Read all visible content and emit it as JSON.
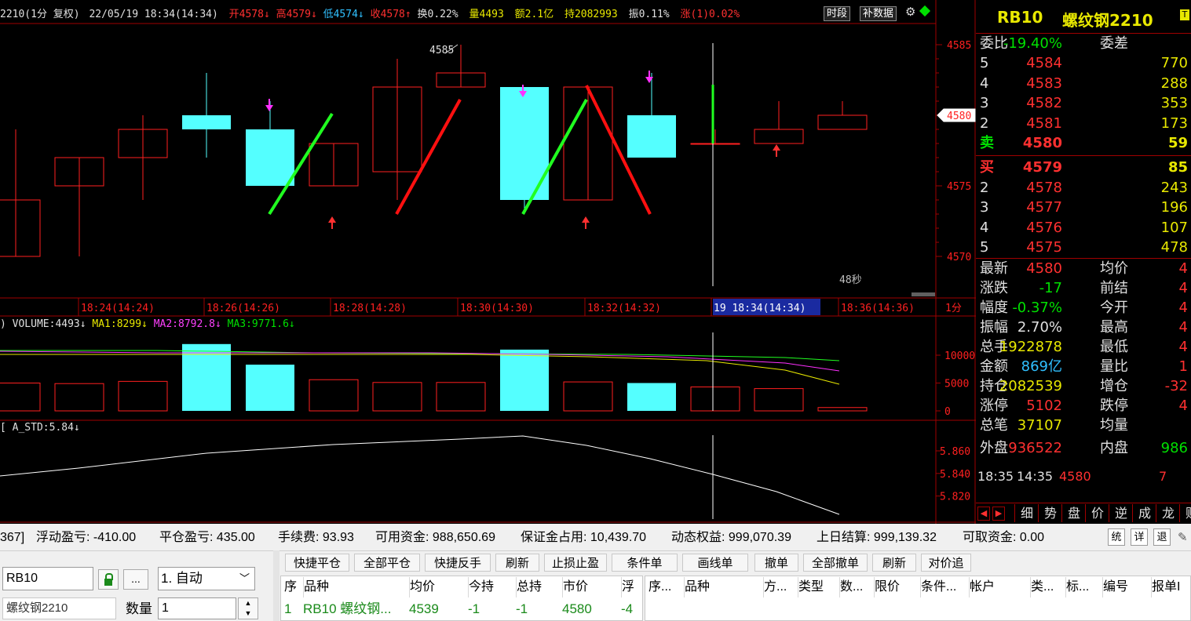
{
  "header": {
    "symbol_period": "2210(1分",
    "adjust": "复权)",
    "datetime": "22/05/19 18:34(14:34)",
    "open": "开4578",
    "high": "高4579",
    "low": "低4574",
    "close": "收4578",
    "turnover": "换0.22%",
    "volume": "量4493",
    "amount": "额2.1亿",
    "position": "持2082993",
    "amplitude": "振0.11%",
    "limit": "涨(1)0.02%",
    "btn_period": "时段",
    "btn_fill": "补数据"
  },
  "price_axis": {
    "ticks": [
      "4585",
      "4580",
      "4575",
      "4570"
    ],
    "current": "4580"
  },
  "main_chart": {
    "peak_label": "4585",
    "countdown": "48秒",
    "candles": [
      {
        "o": 4574.0,
        "c": 4570.0,
        "h": 4579.0,
        "l": 4570.0,
        "color": "red"
      },
      {
        "o": 4575.0,
        "c": 4577.0,
        "h": 4577.0,
        "l": 4570.0,
        "color": "red"
      },
      {
        "o": 4577.0,
        "c": 4579.0,
        "h": 4580.0,
        "l": 4574.0,
        "color": "red"
      },
      {
        "o": 4580.0,
        "c": 4579.0,
        "h": 4583.0,
        "l": 4577.0,
        "color": "cyan"
      },
      {
        "o": 4579.0,
        "c": 4575.0,
        "h": 4581.0,
        "l": 4575.0,
        "color": "cyan"
      },
      {
        "o": 4575.0,
        "c": 4578.0,
        "h": 4578.0,
        "l": 4575.0,
        "color": "red"
      },
      {
        "o": 4576.0,
        "c": 4582.0,
        "h": 4584.0,
        "l": 4574.0,
        "color": "red"
      },
      {
        "o": 4582.0,
        "c": 4583.0,
        "h": 4585.0,
        "l": 4582.0,
        "color": "red"
      },
      {
        "o": 4582.0,
        "c": 4574.0,
        "h": 4582.0,
        "l": 4573.0,
        "color": "cyan"
      },
      {
        "o": 4574.0,
        "c": 4582.0,
        "h": 4582.0,
        "l": 4574.0,
        "color": "red"
      },
      {
        "o": 4580.0,
        "c": 4577.0,
        "h": 4583.0,
        "l": 4577.0,
        "color": "cyan"
      },
      {
        "o": 4578.0,
        "c": 4578.0,
        "h": 4579.0,
        "l": 4578.0,
        "color": "red"
      },
      {
        "o": 4578.0,
        "c": 4579.0,
        "h": 4581.0,
        "l": 4579.0,
        "color": "red"
      },
      {
        "o": 4579.0,
        "c": 4580.0,
        "h": 4581.0,
        "l": 4580.0,
        "color": "red"
      }
    ]
  },
  "time_axis": {
    "labels": [
      "18:24(14:24)",
      "18:26(14:26)",
      "18:28(14:28)",
      "18:30(14:30)",
      "18:32(14:32)",
      "19 18:34(14:34)",
      "18:36(14:36)"
    ],
    "period": "1分"
  },
  "volume_panel": {
    "title": ") VOLUME:4493",
    "ma1": "MA1:8299",
    "ma2": "MA2:8792.8",
    "ma3": "MA3:9771.6",
    "ticks": [
      "10000",
      "5000",
      "0"
    ],
    "bars": [
      {
        "v": 5000,
        "color": "red"
      },
      {
        "v": 4900,
        "color": "red"
      },
      {
        "v": 5300,
        "color": "red"
      },
      {
        "v": 12000,
        "color": "cyan"
      },
      {
        "v": 8300,
        "color": "cyan"
      },
      {
        "v": 5600,
        "color": "red"
      },
      {
        "v": 5100,
        "color": "red"
      },
      {
        "v": 5100,
        "color": "red"
      },
      {
        "v": 11000,
        "color": "cyan"
      },
      {
        "v": 5200,
        "color": "red"
      },
      {
        "v": 5000,
        "color": "cyan"
      },
      {
        "v": 4300,
        "color": "red"
      },
      {
        "v": 4000,
        "color": "red"
      },
      {
        "v": 600,
        "color": "red"
      }
    ]
  },
  "std_panel": {
    "title": "[ A_STD:5.84",
    "ticks": [
      "5.860",
      "5.840",
      "5.820"
    ]
  },
  "quote": {
    "symbol": "RB10",
    "name": "螺纹钢2210",
    "ratio_label": "委比",
    "ratio_value": "-19.40%",
    "diff_label": "委差",
    "asks": [
      {
        "level": "5",
        "price": "4584",
        "vol": "770"
      },
      {
        "level": "4",
        "price": "4583",
        "vol": "288"
      },
      {
        "level": "3",
        "price": "4582",
        "vol": "353"
      },
      {
        "level": "2",
        "price": "4581",
        "vol": "173"
      },
      {
        "level": "卖",
        "price": "4580",
        "vol": "59"
      }
    ],
    "bids": [
      {
        "level": "买",
        "price": "4579",
        "vol": "85"
      },
      {
        "level": "2",
        "price": "4578",
        "vol": "243"
      },
      {
        "level": "3",
        "price": "4577",
        "vol": "196"
      },
      {
        "level": "4",
        "price": "4576",
        "vol": "107"
      },
      {
        "level": "5",
        "price": "4575",
        "vol": "478"
      }
    ],
    "stats": [
      {
        "l1": "最新",
        "v1": "4580",
        "l2": "均价",
        "v2": "4",
        "c": "#ff3030"
      },
      {
        "l1": "涨跌",
        "v1": "-17",
        "l2": "前结",
        "v2": "4",
        "c": "#00e000"
      },
      {
        "l1": "幅度",
        "v1": "-0.37%",
        "l2": "今开",
        "v2": "4",
        "c": "#00e000"
      },
      {
        "l1": "振幅",
        "v1": "2.70%",
        "l2": "最高",
        "v2": "4",
        "c": "#e0e0e0"
      },
      {
        "l1": "总手",
        "v1": "1922878",
        "l2": "最低",
        "v2": "4",
        "c": "#e8e800"
      },
      {
        "l1": "金额",
        "v1": "869亿",
        "l2": "量比",
        "v2": "1",
        "c": "#30c0ff"
      },
      {
        "l1": "持仓",
        "v1": "2082539",
        "l2": "增仓",
        "v2": "-32",
        "c": "#e8e800"
      },
      {
        "l1": "涨停",
        "v1": "5102",
        "l2": "跌停",
        "v2": "4",
        "c": "#ff3030"
      },
      {
        "l1": "总笔",
        "v1": "37107",
        "l2": "均量",
        "v2": "",
        "c": "#e8e800"
      }
    ],
    "outer_label": "外盘",
    "outer_value": "936522",
    "inner_label": "内盘",
    "inner_value": "986",
    "tick_time": "18:35",
    "tick_time2": "14:35",
    "tick_price": "4580",
    "tick_vol": "7",
    "tabs": [
      "细",
      "势",
      "盘",
      "价",
      "逆",
      "成",
      "龙",
      "财"
    ]
  },
  "account": {
    "id_fragment": "367]",
    "float_pl": "浮动盈亏: -410.00",
    "close_pl": "平仓盈亏: 435.00",
    "fee": "手续费: 93.93",
    "available": "可用资金: 988,650.69",
    "margin": "保证金占用: 10,439.70",
    "equity": "动态权益: 999,070.39",
    "prev_settle": "上日结算: 999,139.32",
    "withdrawable": "可取资金: 0.00",
    "icons": [
      "统",
      "详",
      "退"
    ]
  },
  "order": {
    "symbol_value": "RB10",
    "ellipsis": "...",
    "mode": "1. 自动",
    "product_name": "螺纹钢2210",
    "qty_label": "数量",
    "qty_value": "1"
  },
  "actions": [
    "快捷平仓",
    "全部平仓",
    "快捷反手",
    "刷新",
    "止损止盈",
    "条件单",
    "画线单",
    "撤单",
    "全部撤单",
    "刷新",
    "对价追"
  ],
  "positions": {
    "headers": [
      "序",
      "品种",
      "均价",
      "今持",
      "总持",
      "市价",
      "浮"
    ],
    "row": [
      "1",
      "RB10 螺纹钢...",
      "4539",
      "-1",
      "-1",
      "4580",
      "-4"
    ]
  },
  "orders_table": {
    "headers": [
      "序...",
      "品种",
      "方...",
      "类型",
      "数...",
      "限价",
      "条件...",
      "帐户",
      "类...",
      "标...",
      "编号",
      "报单I"
    ]
  }
}
